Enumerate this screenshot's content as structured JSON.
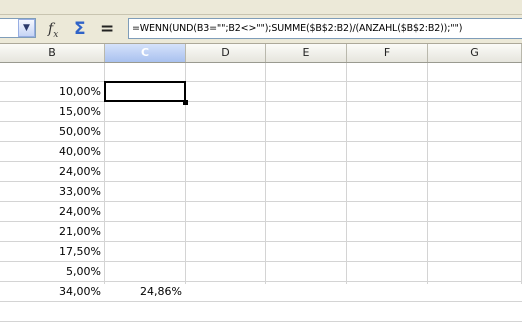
{
  "formula_bar": {
    "name_box_value": "",
    "function_wizard_icon": "fx-icon",
    "sum_icon": "sigma-icon",
    "function_icon": "equals-icon",
    "formula": "=WENN(UND(B3=\"\";B2<>\"\");SUMME($B$2:B2)/(ANZAHL($B$2:B2));\"\")"
  },
  "columns": [
    {
      "label": "B"
    },
    {
      "label": "C",
      "active": true
    },
    {
      "label": "D"
    },
    {
      "label": "E"
    },
    {
      "label": "F"
    },
    {
      "label": "G"
    }
  ],
  "rows": [
    {
      "b": "",
      "c": ""
    },
    {
      "b": "10,00%",
      "c": ""
    },
    {
      "b": "15,00%",
      "c": ""
    },
    {
      "b": "50,00%",
      "c": ""
    },
    {
      "b": "40,00%",
      "c": ""
    },
    {
      "b": "24,00%",
      "c": ""
    },
    {
      "b": "33,00%",
      "c": ""
    },
    {
      "b": "24,00%",
      "c": ""
    },
    {
      "b": "21,00%",
      "c": ""
    },
    {
      "b": "17,50%",
      "c": ""
    },
    {
      "b": "5,00%",
      "c": ""
    },
    {
      "b": "34,00%",
      "c": "24,86%"
    },
    {
      "b": "",
      "c": ""
    }
  ],
  "colors": {
    "active_header": "#a9c1ef",
    "gridline": "#d4d4d4",
    "toolbar": "#ece9d8"
  }
}
